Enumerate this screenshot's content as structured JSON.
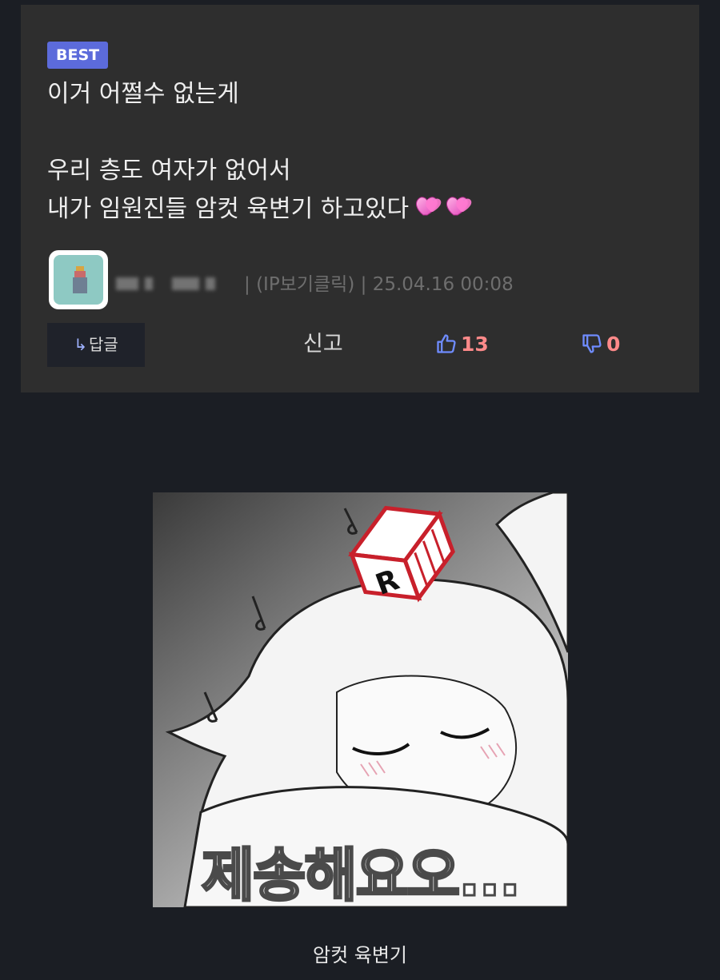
{
  "comment": {
    "badge": "BEST",
    "lines": [
      "이거 어쩔수 없는게",
      "",
      "우리 층도 여자가 없어서",
      "내가 임원진들 암컷 육변기 하고있다"
    ],
    "emoji": "two-hearts-icon",
    "ip_label": "(IP보기클릭)",
    "timestamp": "25.04.16 00:08",
    "separator": "|",
    "reply_label": "답글",
    "report_label": "신고",
    "like_count": "13",
    "dislike_count": "0"
  },
  "image": {
    "overlay_text": "제송해요오...",
    "caption": "암컷 육변기"
  },
  "colors": {
    "page_bg": "#1b1e24",
    "card_bg": "#2e2e2e",
    "badge_bg": "#5c6bdb",
    "vote_count": "#ff8a8a",
    "thumb_icon": "#6f8cff"
  }
}
